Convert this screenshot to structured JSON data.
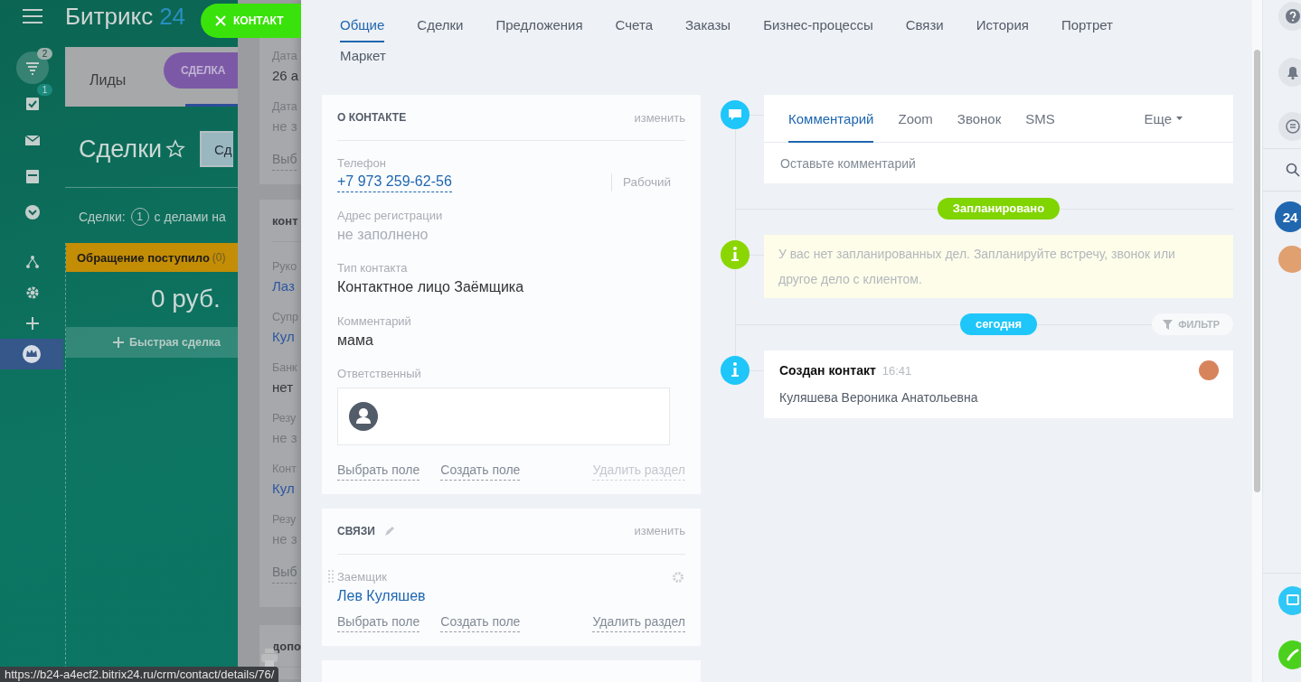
{
  "background_app": {
    "logo": {
      "name": "Битрикс",
      "number": "24"
    },
    "sidebar": [
      {
        "kind": "filter",
        "badge": "2",
        "selected": false
      },
      {
        "kind": "tasks",
        "badge": "1",
        "selected": false
      },
      {
        "kind": "mail",
        "selected": false
      },
      {
        "kind": "calendar",
        "selected": false
      },
      {
        "kind": "more",
        "selected": false
      },
      {
        "kind": "structure",
        "selected": false
      },
      {
        "kind": "settings",
        "selected": false
      },
      {
        "kind": "add",
        "selected": false
      },
      {
        "kind": "crown",
        "selected": true
      }
    ],
    "crm_tabs": [
      {
        "label": "Лиды",
        "selected": false
      }
    ],
    "page_title": "Сделки",
    "header_button": "Сд",
    "counter": {
      "label": "Сделки:",
      "count": "1",
      "text": "с делами на"
    },
    "stage": {
      "name": "Обращение поступило",
      "count": "(0)",
      "color": "#c38d06"
    },
    "total": "0 руб.",
    "quick_add": "Быстрая сделка"
  },
  "deal_slider": {
    "label": "СДЕЛКА",
    "sections": [
      {
        "fields": [
          {
            "label": "Дата",
            "value": "26 а",
            "kind": "text"
          },
          {
            "label": "Дата",
            "value": "не з",
            "kind": "empty"
          }
        ],
        "footer": "Выб"
      },
      {
        "title": "конт",
        "fields": [
          {
            "label": "Руко",
            "value": "Лаз",
            "kind": "link"
          },
          {
            "label": "Супр",
            "value": "Кул",
            "kind": "link"
          },
          {
            "label": "Банк",
            "value": "нет",
            "kind": "text"
          },
          {
            "label": "Резу",
            "value": "не з",
            "kind": "empty"
          },
          {
            "label": "Конт",
            "value": "Кул",
            "kind": "link"
          },
          {
            "label": "Резу",
            "value": "не з",
            "kind": "empty"
          }
        ],
        "footer": "Выб"
      },
      {
        "title": "допо"
      }
    ]
  },
  "contact_slider": {
    "close_label": "КОНТАКТ",
    "tabs": [
      {
        "label": "Общие",
        "selected": true
      },
      {
        "label": "Сделки",
        "selected": false
      },
      {
        "label": "Предложения",
        "selected": false
      },
      {
        "label": "Счета",
        "selected": false
      },
      {
        "label": "Заказы",
        "selected": false
      },
      {
        "label": "Бизнес-процессы",
        "selected": false
      },
      {
        "label": "Связи",
        "selected": false
      },
      {
        "label": "История",
        "selected": false
      },
      {
        "label": "Портрет",
        "selected": false
      },
      {
        "label": "Маркет",
        "selected": false
      }
    ],
    "sections": [
      {
        "title": "О КОНТАКТЕ",
        "edit": "изменить",
        "fields": [
          {
            "kind": "phone",
            "label": "Телефон",
            "value": "+7 973 259-62-56",
            "type": "Рабочий"
          },
          {
            "kind": "empty",
            "label": "Адрес регистрации",
            "value": "не заполнено"
          },
          {
            "kind": "text",
            "label": "Тип контакта",
            "value": "Контактное лицо Заёмщика"
          },
          {
            "kind": "text",
            "label": "Комментарий",
            "value": "мама"
          },
          {
            "kind": "user",
            "label": "Ответственный"
          }
        ],
        "actions": [
          {
            "label": "Выбрать поле",
            "disabled": false
          },
          {
            "label": "Создать поле",
            "disabled": false
          },
          {
            "label": "Удалить раздел",
            "disabled": true
          }
        ]
      },
      {
        "title": "СВЯЗИ",
        "edit": "изменить",
        "fields": [
          {
            "kind": "link",
            "label": "Заемщик",
            "value": "Лев Куляшев"
          }
        ],
        "actions": [
          {
            "label": "Выбрать поле",
            "disabled": false
          },
          {
            "label": "Создать поле",
            "disabled": false
          },
          {
            "label": "Удалить раздел",
            "disabled": false
          }
        ]
      }
    ],
    "timeline": {
      "composer_tabs": [
        {
          "label": "Комментарий",
          "selected": true
        },
        {
          "label": "Zoom",
          "selected": false
        },
        {
          "label": "Звонок",
          "selected": false
        },
        {
          "label": "SMS",
          "selected": false
        }
      ],
      "more": "Еще",
      "placeholder": "Оставьте комментарий",
      "planned_label": "Запланировано",
      "planned_note": "У вас нет запланированных дел. Запланируйте встречу, звонок или другое дело с клиентом.",
      "today_label": "сегодня",
      "filter": "ФИЛЬТР",
      "events": [
        {
          "title": "Создан контакт",
          "time": "16:41",
          "text": "Куляшева Вероника Анатольевна"
        }
      ]
    }
  },
  "right_bar": {
    "badge_text": "24"
  },
  "status_url": "https://b24-a4ecf2.bitrix24.ru/crm/contact/details/76/"
}
